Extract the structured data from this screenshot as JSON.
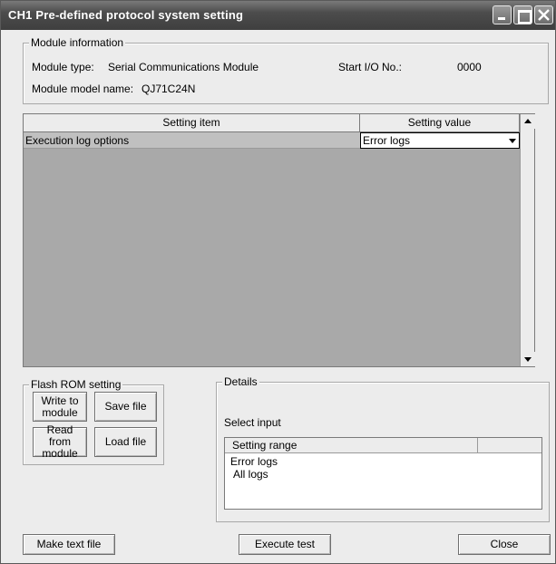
{
  "window": {
    "title": "CH1 Pre-defined protocol system setting"
  },
  "module_info": {
    "group_title": "Module information",
    "type_label": "Module type:",
    "type_value": "Serial Communications Module",
    "start_io_label": "Start I/O No.:",
    "start_io_value": "0000",
    "model_label": "Module model name:",
    "model_value": "QJ71C24N"
  },
  "grid": {
    "col_item": "Setting item",
    "col_value": "Setting value",
    "rows": [
      {
        "item": "Execution log options",
        "value": "Error logs"
      }
    ]
  },
  "flash_rom": {
    "group_title": "Flash ROM setting",
    "write_line1": "Write to",
    "write_line2": "module",
    "save_file": "Save file",
    "read_line1": "Read from",
    "read_line2": "module",
    "load_file": "Load file"
  },
  "details": {
    "group_title": "Details",
    "select_input": "Select input",
    "list_header": "Setting range",
    "options": [
      "Error logs",
      "All logs"
    ]
  },
  "footer": {
    "make_text_file": "Make text file",
    "execute_test": "Execute test",
    "close": "Close"
  },
  "colors": {
    "titlebar": "#4c4c4c",
    "grid_background": "#a9a9a9",
    "window_face": "#ececec"
  }
}
